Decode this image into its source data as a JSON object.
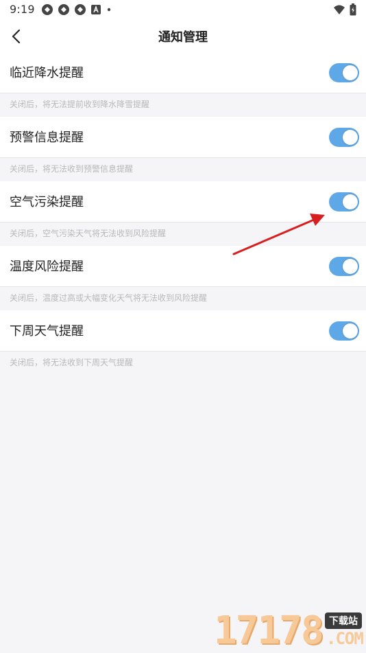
{
  "status_bar": {
    "time": "9:19",
    "left_icons": [
      "app-icon",
      "app-icon",
      "app-icon",
      "a-icon",
      "dot-icon"
    ],
    "right_icons": [
      "wifi-icon",
      "battery-icon"
    ]
  },
  "header": {
    "title": "通知管理",
    "back_icon": "chevron-left-icon"
  },
  "settings": [
    {
      "label": "临近降水提醒",
      "enabled": true,
      "description": "关闭后，将无法提前收到降水降雪提醒"
    },
    {
      "label": "预警信息提醒",
      "enabled": true,
      "description": "关闭后，将无法收到预警信息提醒"
    },
    {
      "label": "空气污染提醒",
      "enabled": true,
      "description": "关闭后，空气污染天气将无法收到风险提醒"
    },
    {
      "label": "温度风险提醒",
      "enabled": true,
      "description": "关闭后，温度过高或大幅变化天气将无法收到风险提醒"
    },
    {
      "label": "下周天气提醒",
      "enabled": true,
      "description": "关闭后，将无法收到下周天气提醒"
    }
  ],
  "colors": {
    "toggle_on": "#5fa8e8",
    "annotation_arrow": "#d81e1e"
  },
  "watermark": {
    "digits": "17178",
    "badge": "下载站",
    "suffix": ".COM"
  }
}
